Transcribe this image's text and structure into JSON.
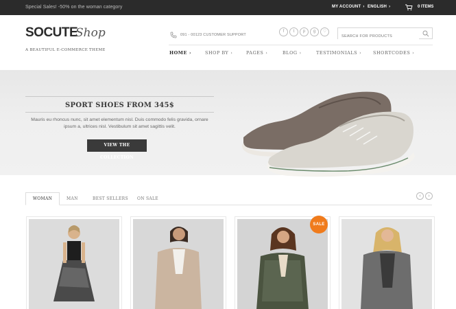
{
  "topbar": {
    "promo": "Special Sales! -50% on the woman category",
    "account": "MY ACCOUNT",
    "language": "ENGLISH",
    "cart_count": "0 ITEMS"
  },
  "header": {
    "logo_main": "SOCUTE",
    "logo_script": "Shop",
    "tagline": "A BEAUTIFUL E-COMMERCE THEME",
    "phone": "091 - 00123 CUSTOMER SUPPORT",
    "search_placeholder": "SEARCH FOR PRODUCTS",
    "social_icons": [
      "facebook-icon",
      "twitter-icon",
      "pinterest-icon",
      "google-plus-icon",
      "heart-icon"
    ]
  },
  "nav": {
    "items": [
      {
        "label": "HOME",
        "active": true
      },
      {
        "label": "SHOP BY"
      },
      {
        "label": "PAGES"
      },
      {
        "label": "BLOG"
      },
      {
        "label": "TESTIMONIALS"
      },
      {
        "label": "SHORTCODES"
      }
    ]
  },
  "hero": {
    "title": "SPORT SHOES FROM 345$",
    "text_line1": "Mauris eu rhoncus nunc, sit amet elementum nisl. Duis commodo felis gravida, ornare",
    "text_line2": "ipsum a, ultrices nisl. Vestibulum sit amet sagittis velit.",
    "button": "VIEW THE COLLECTION"
  },
  "tabs": {
    "items": [
      "WOMAN",
      "MAN",
      "BEST SELLERS",
      "ON SALE"
    ],
    "active": "WOMAN"
  },
  "products": {
    "sale_badge": "SALE"
  },
  "colors": {
    "topbar": "#2b2b2b",
    "accent_sale": "#f07b1c",
    "button": "#3a3a3a"
  }
}
